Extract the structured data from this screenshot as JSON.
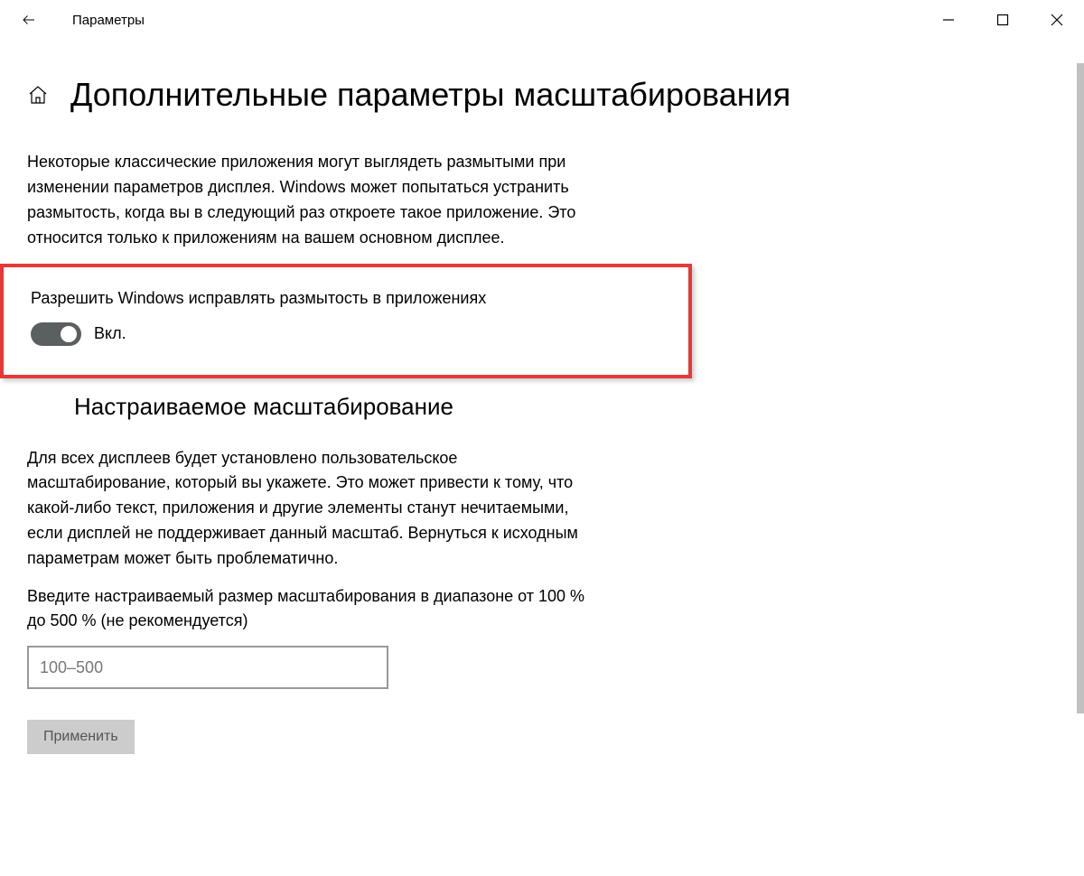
{
  "titlebar": {
    "title": "Параметры"
  },
  "page": {
    "title": "Дополнительные параметры масштабирования",
    "intro_text": "Некоторые классические приложения могут выглядеть размытыми при изменении параметров дисплея. Windows может попытаться устранить размытость, когда вы в следующий раз откроете такое приложение. Это относится только к приложениям на вашем основном дисплее."
  },
  "fix_blur": {
    "label": "Разрешить Windows исправлять размытость в приложениях",
    "toggle_state": "Вкл."
  },
  "custom_scaling": {
    "heading": "Настраиваемое масштабирование",
    "description": "Для всех дисплеев будет установлено пользовательское масштабирование, который вы укажете. Это может привести к тому, что какой-либо текст, приложения и другие элементы станут нечитаемыми, если дисплей не поддерживает данный масштаб. Вернуться к исходным параметрам может быть проблематично.",
    "input_label": "Введите настраиваемый размер масштабирования в диапазоне от 100 % до 500 % (не рекомендуется)",
    "input_placeholder": "100–500",
    "apply_label": "Применить"
  }
}
